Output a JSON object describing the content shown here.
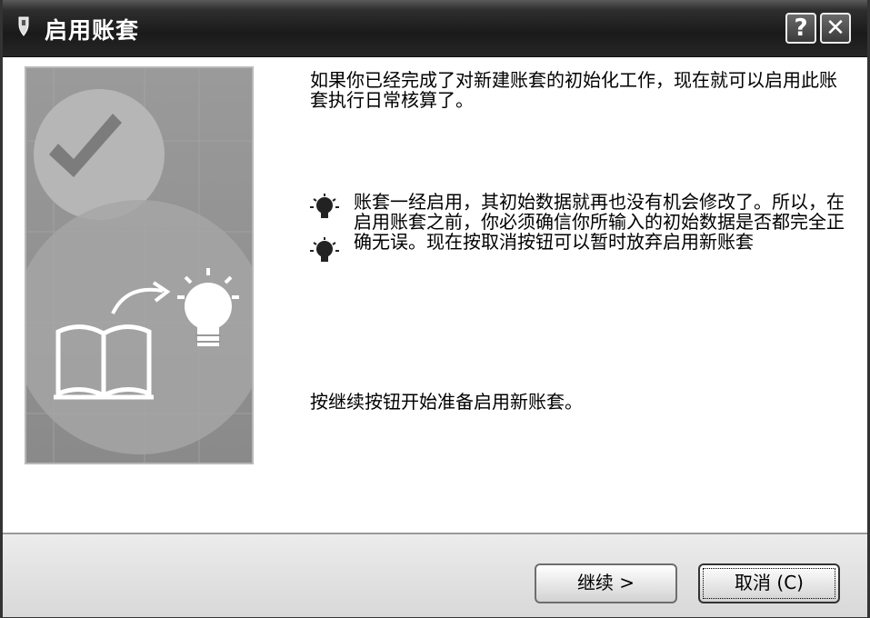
{
  "window": {
    "title": "启用账套",
    "help_label": "?",
    "close_label": "✕"
  },
  "content": {
    "intro": "如果你已经完成了对新建账套的初始化工作，现在就可以启用此账套执行日常核算了。",
    "warning": "账套一经启用，其初始数据就再也没有机会修改了。所以，在启用账套之前，你必须确信你所输入的初始数据是否都完全正确无误。现在按取消按钮可以暂时放弃启用新账套",
    "continue_hint": "按继续按钮开始准备启用新账套。",
    "icons": [
      "app-icon",
      "checkmark-icon",
      "book-icon",
      "lightbulb-icon",
      "bulb-tip-icon"
    ]
  },
  "footer": {
    "next_label": "继续 >",
    "cancel_label": "取消 (C)"
  }
}
